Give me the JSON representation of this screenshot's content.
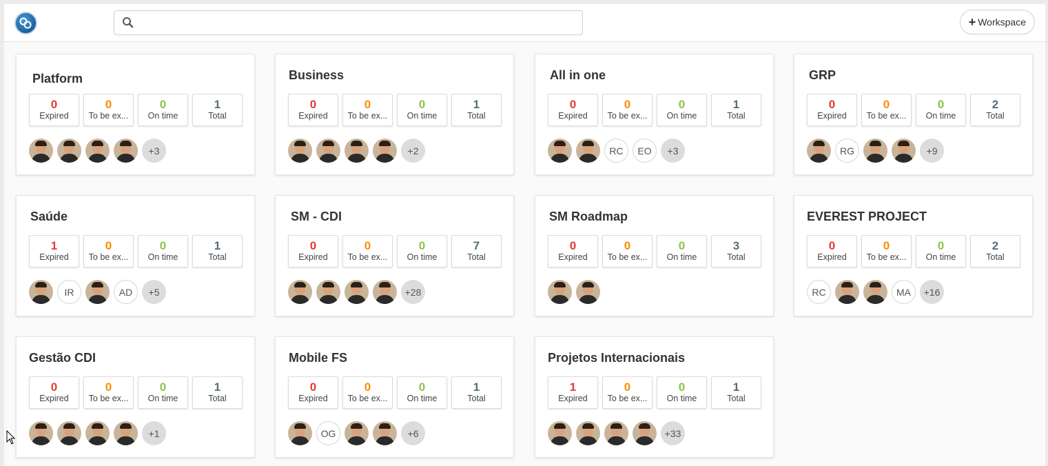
{
  "app": {
    "logo_icon": "infinity-logo-icon",
    "search": {
      "placeholder": "",
      "value": ""
    },
    "add_workspace_label": "Workspace",
    "add_workspace_icon": "plus-icon"
  },
  "stat_labels": {
    "expired": "Expired",
    "to_be_expired": "To be ex...",
    "on_time": "On time",
    "total": "Total"
  },
  "colors": {
    "expired": "#e53935",
    "to_be_expired": "#fb8c00",
    "on_time": "#8bc34a",
    "total": "#546e7a"
  },
  "workspaces": [
    {
      "title": "Platform",
      "expired": "0",
      "to_be_expired": "0",
      "on_time": "0",
      "total": "1",
      "members": [
        {
          "kind": "photo"
        },
        {
          "kind": "photo"
        },
        {
          "kind": "photo"
        },
        {
          "kind": "photo"
        },
        {
          "kind": "more",
          "text": "+3"
        }
      ]
    },
    {
      "title": "Business",
      "expired": "0",
      "to_be_expired": "0",
      "on_time": "0",
      "total": "1",
      "members": [
        {
          "kind": "photo"
        },
        {
          "kind": "photo"
        },
        {
          "kind": "photo"
        },
        {
          "kind": "photo"
        },
        {
          "kind": "more",
          "text": "+2"
        }
      ]
    },
    {
      "title": "All in one",
      "expired": "0",
      "to_be_expired": "0",
      "on_time": "0",
      "total": "1",
      "members": [
        {
          "kind": "photo"
        },
        {
          "kind": "photo"
        },
        {
          "kind": "initials",
          "text": "RC"
        },
        {
          "kind": "initials",
          "text": "EO"
        },
        {
          "kind": "more",
          "text": "+3"
        }
      ]
    },
    {
      "title": "GRP",
      "expired": "0",
      "to_be_expired": "0",
      "on_time": "0",
      "total": "2",
      "members": [
        {
          "kind": "photo"
        },
        {
          "kind": "initials",
          "text": "RG"
        },
        {
          "kind": "photo"
        },
        {
          "kind": "photo"
        },
        {
          "kind": "more",
          "text": "+9"
        }
      ]
    },
    {
      "title": "Saúde",
      "expired": "1",
      "to_be_expired": "0",
      "on_time": "0",
      "total": "1",
      "members": [
        {
          "kind": "photo"
        },
        {
          "kind": "initials",
          "text": "IR"
        },
        {
          "kind": "photo"
        },
        {
          "kind": "initials",
          "text": "AD"
        },
        {
          "kind": "more",
          "text": "+5"
        }
      ]
    },
    {
      "title": "SM - CDI",
      "expired": "0",
      "to_be_expired": "0",
      "on_time": "0",
      "total": "7",
      "members": [
        {
          "kind": "photo"
        },
        {
          "kind": "photo"
        },
        {
          "kind": "photo"
        },
        {
          "kind": "photo"
        },
        {
          "kind": "more",
          "text": "+28"
        }
      ]
    },
    {
      "title": "SM Roadmap",
      "expired": "0",
      "to_be_expired": "0",
      "on_time": "0",
      "total": "3",
      "members": [
        {
          "kind": "photo"
        },
        {
          "kind": "photo"
        }
      ]
    },
    {
      "title": "EVEREST PROJECT",
      "expired": "0",
      "to_be_expired": "0",
      "on_time": "0",
      "total": "2",
      "members": [
        {
          "kind": "initials",
          "text": "RC"
        },
        {
          "kind": "photo"
        },
        {
          "kind": "photo"
        },
        {
          "kind": "initials",
          "text": "MA"
        },
        {
          "kind": "more",
          "text": "+16"
        }
      ]
    },
    {
      "title": "Gestão CDI",
      "expired": "0",
      "to_be_expired": "0",
      "on_time": "0",
      "total": "1",
      "members": [
        {
          "kind": "photo"
        },
        {
          "kind": "photo"
        },
        {
          "kind": "photo"
        },
        {
          "kind": "photo"
        },
        {
          "kind": "more",
          "text": "+1"
        }
      ]
    },
    {
      "title": "Mobile FS",
      "expired": "0",
      "to_be_expired": "0",
      "on_time": "0",
      "total": "1",
      "members": [
        {
          "kind": "photo"
        },
        {
          "kind": "initials",
          "text": "OG"
        },
        {
          "kind": "photo"
        },
        {
          "kind": "photo"
        },
        {
          "kind": "more",
          "text": "+6"
        }
      ]
    },
    {
      "title": "Projetos Internacionais",
      "expired": "1",
      "to_be_expired": "0",
      "on_time": "0",
      "total": "1",
      "members": [
        {
          "kind": "photo"
        },
        {
          "kind": "photo"
        },
        {
          "kind": "photo"
        },
        {
          "kind": "photo"
        },
        {
          "kind": "more",
          "text": "+33"
        }
      ]
    }
  ]
}
